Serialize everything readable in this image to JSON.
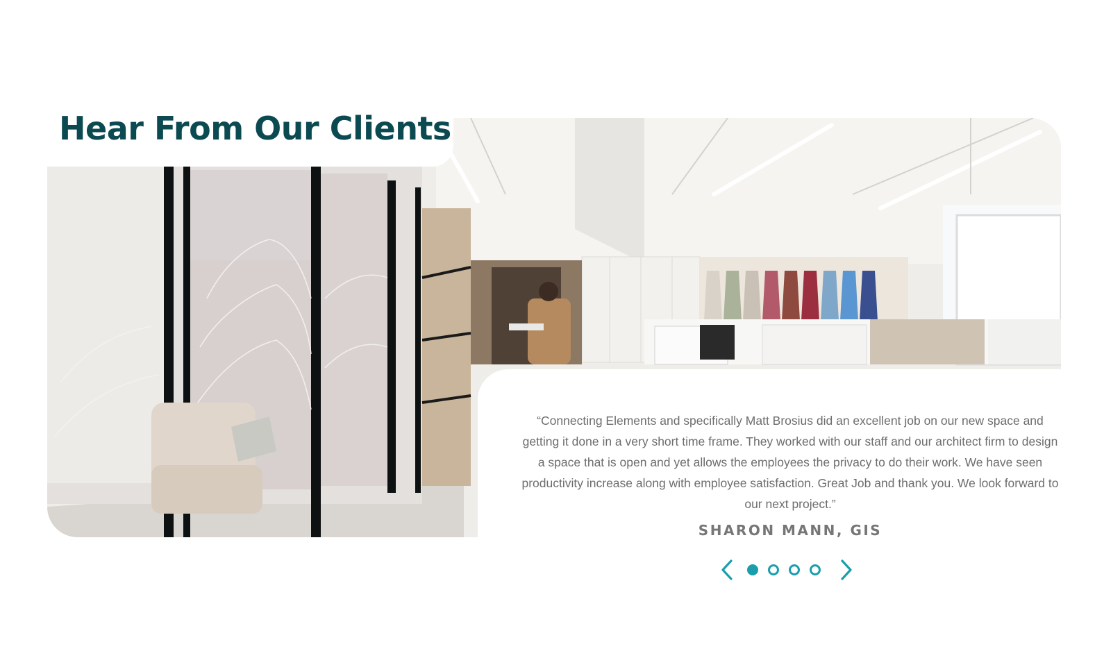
{
  "section": {
    "title": "Hear From Our Clients"
  },
  "testimonial": {
    "quote": "“Connecting Elements and specifically Matt Brosius did an excellent job on our new space and getting it done in a very short time frame. They worked with our staff and our architect firm to design a space that is open and yet allows the employees the privacy to do their work. We have seen productivity increase along with employee satisfaction. Great Job and thank you. We look forward to our next project.”",
    "author": "SHARON MANN, GIS"
  },
  "carousel": {
    "slide_count": 4,
    "active_index": 0,
    "prev_icon": "chevron-left-icon",
    "next_icon": "chevron-right-icon"
  },
  "colors": {
    "title": "#0c4a52",
    "accent": "#1a9eac",
    "body_text": "#6d6d6d",
    "author_text": "#767676"
  }
}
